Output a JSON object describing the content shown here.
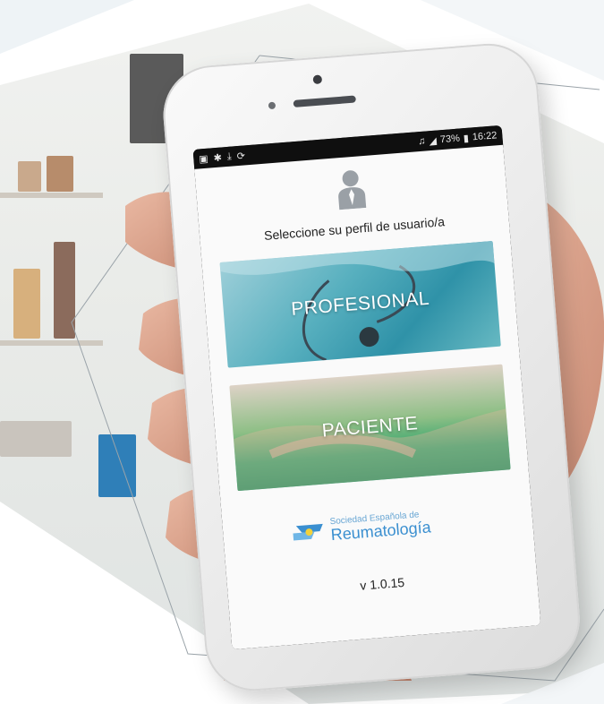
{
  "status_bar": {
    "left_icons": [
      "notification-icon",
      "bluetooth-icon",
      "download-icon",
      "sync-icon"
    ],
    "battery": "73%",
    "time": "16:22"
  },
  "app": {
    "title": "Seleccione su perfil de usuario/a",
    "options": [
      {
        "label": "PROFESIONAL",
        "icon": "stethoscope-image"
      },
      {
        "label": "PACIENTE",
        "icon": "handshake-image"
      }
    ],
    "logo": {
      "small_text": "Sociedad Española de",
      "big_text": "Reumatología"
    },
    "version": "v 1.0.15"
  },
  "colors": {
    "accent_blue": "#3a8fd0",
    "profesional_card": "#3a9db1",
    "paciente_card": "#2da36b"
  }
}
